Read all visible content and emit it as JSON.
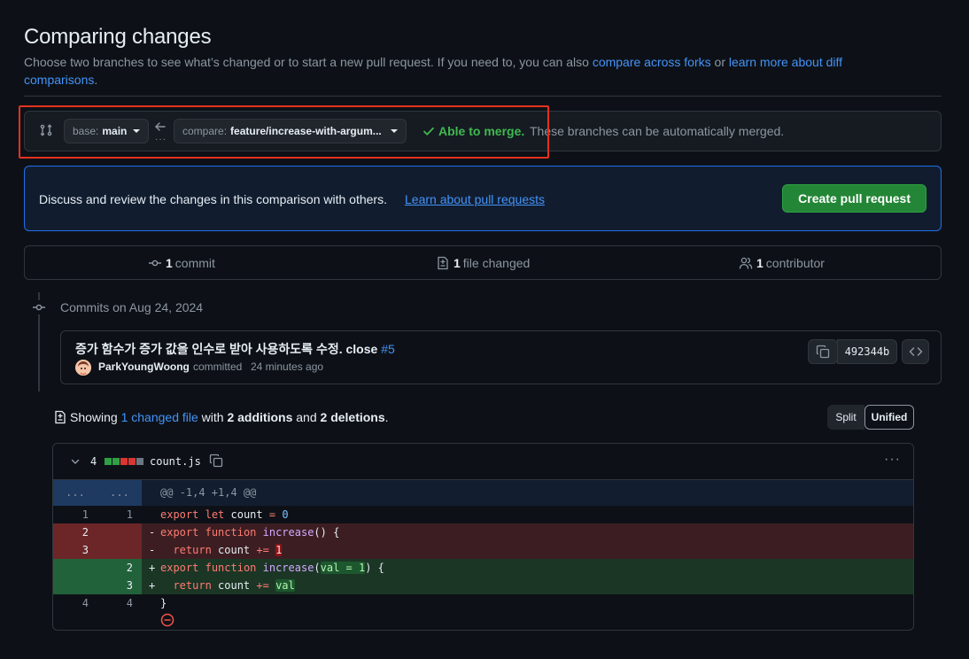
{
  "header": {
    "title": "Comparing changes",
    "desc_prefix": "Choose two branches to see what’s changed or to start a new pull request. If you need to, you can also ",
    "link_forks": "compare across forks",
    "desc_or": " or ",
    "link_learn": "learn more about diff comparisons",
    "desc_suffix": "."
  },
  "range": {
    "base_prefix": "base:",
    "base_branch": "main",
    "compare_prefix": "compare:",
    "compare_branch": "feature/increase-with-argum...",
    "merge_status": "Able to merge.",
    "merge_detail": "These branches can be automatically merged."
  },
  "discuss": {
    "text": "Discuss and review the changes in this comparison with others.",
    "link": "Learn about pull requests",
    "button": "Create pull request"
  },
  "stats": {
    "commits_count": "1",
    "commits_label": "commit",
    "files_count": "1",
    "files_label": "file changed",
    "contributors_count": "1",
    "contributors_label": "contributor"
  },
  "timeline": {
    "date_label": "Commits on Aug 24, 2024"
  },
  "commit": {
    "message": "증가 함수가 증가 값을 인수로 받아 사용하도록 수정. close ",
    "issue_ref": "#5",
    "author": "ParkYoungWoong",
    "action": "committed",
    "time": "24 minutes ago",
    "sha": "492344b"
  },
  "summary": {
    "showing": "Showing ",
    "files_link": "1 changed file",
    "with": " with ",
    "additions": "2 additions",
    "and": " and ",
    "deletions": "2 deletions",
    "period": ".",
    "split_label": "Split",
    "unified_label": "Unified"
  },
  "file": {
    "changes": "4",
    "name": "count.js",
    "hunk_expander": "...",
    "hunk_header": "@@ -1,4 +1,4 @@",
    "change_bar": [
      "add",
      "add",
      "del",
      "del",
      "neutral"
    ]
  },
  "diff_lines": [
    {
      "type": "ctx",
      "old": "1",
      "new": "1",
      "sign": "",
      "parts": [
        [
          "kw",
          "export"
        ],
        [
          "t",
          " "
        ],
        [
          "kw",
          "let"
        ],
        [
          "t",
          " count "
        ],
        [
          "kw",
          "="
        ],
        [
          "t",
          " "
        ],
        [
          "num",
          "0"
        ]
      ]
    },
    {
      "type": "del",
      "old": "2",
      "new": "",
      "sign": "-",
      "parts": [
        [
          "kw",
          "export"
        ],
        [
          "t",
          " "
        ],
        [
          "kw",
          "function"
        ],
        [
          "t",
          " "
        ],
        [
          "fn",
          "increase"
        ],
        [
          "t",
          "() {"
        ]
      ]
    },
    {
      "type": "del",
      "old": "3",
      "new": "",
      "sign": "-",
      "parts": [
        [
          "t",
          "  "
        ],
        [
          "kw",
          "return"
        ],
        [
          "t",
          " count "
        ],
        [
          "kw",
          "+="
        ],
        [
          "t",
          " "
        ],
        [
          "mkdel",
          "1"
        ]
      ]
    },
    {
      "type": "add",
      "old": "",
      "new": "2",
      "sign": "+",
      "parts": [
        [
          "kw",
          "export"
        ],
        [
          "t",
          " "
        ],
        [
          "kw",
          "function"
        ],
        [
          "t",
          " "
        ],
        [
          "fn",
          "increase"
        ],
        [
          "t",
          "("
        ],
        [
          "mkadd",
          "val = 1"
        ],
        [
          "t",
          ") {"
        ]
      ]
    },
    {
      "type": "add",
      "old": "",
      "new": "3",
      "sign": "+",
      "parts": [
        [
          "t",
          "  "
        ],
        [
          "kw",
          "return"
        ],
        [
          "t",
          " count "
        ],
        [
          "kw",
          "+="
        ],
        [
          "t",
          " "
        ],
        [
          "mkadd",
          "val"
        ]
      ]
    },
    {
      "type": "ctx",
      "old": "4",
      "new": "4",
      "sign": "",
      "parts": [
        [
          "t",
          "}"
        ]
      ]
    }
  ],
  "colors": {
    "accent": "#4493f8",
    "success": "#3fb950",
    "danger": "#f85149",
    "create_button": "#238636"
  }
}
